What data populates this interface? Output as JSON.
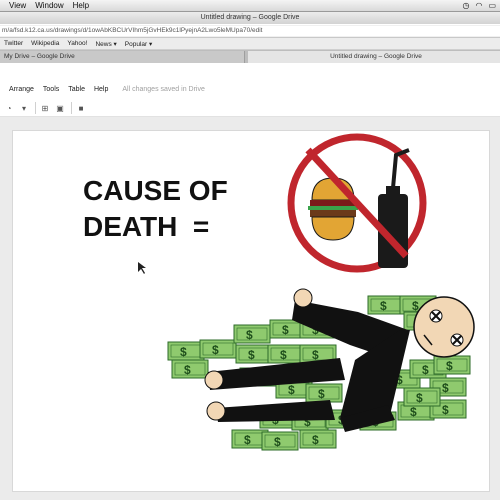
{
  "macMenu": {
    "items": [
      "View",
      "Window",
      "Help"
    ]
  },
  "window": {
    "title": "Untitled drawing – Google Drive"
  },
  "address": {
    "url": "m/a/fsd.k12.ca.us/drawings/d/1owAbKBCUrVIhm5jGvHEk9c1lPyejnA2Lwo5leMUpa70/edit"
  },
  "bookmarks": [
    "Twitter",
    "Wikipedia",
    "Yahoo!",
    "News ▾",
    "Popular ▾"
  ],
  "tabs": [
    "My Drive – Google Drive",
    "Untitled drawing – Google Drive"
  ],
  "docMenus": [
    "Arrange",
    "Tools",
    "Table",
    "Help"
  ],
  "status": "All changes saved in Drive",
  "drawing": {
    "text_line1": "CAUSE OF",
    "text_line2": "DEATH  ="
  },
  "colors": {
    "money": "#8fca6e",
    "prohibit": "#c0262d",
    "bottle": "#1a1a1a"
  },
  "icons": [
    "wifi-icon",
    "battery-icon",
    "clock-icon",
    "shape-icon",
    "table-icon",
    "image-icon",
    "comment-icon"
  ]
}
